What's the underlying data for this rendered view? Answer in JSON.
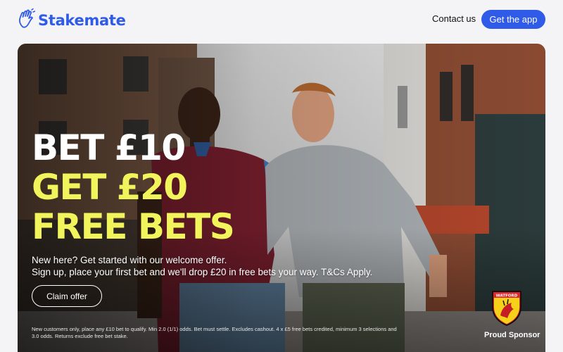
{
  "brand": {
    "name": "Stakemate",
    "color": "#2f5be8"
  },
  "nav": {
    "contact_label": "Contact us",
    "app_button_label": "Get the app"
  },
  "hero": {
    "headline_line1": "BET £10",
    "headline_line2": "GET £20",
    "headline_line3": "FREE BETS",
    "sub_line1": "New here? Get started with our welcome offer.",
    "sub_line2": "Sign up, place your first bet and we'll drop £20 in free bets your way. T&Cs Apply.",
    "cta_label": "Claim offer",
    "terms_line1": "New customers only, place any £10 bet to qualify. Min 2.0 (1/1) odds. Bet must settle. Excludes cashout. 4 x £5 free bets credited, minimum 3 selections and",
    "terms_line2": "3.0 odds. Returns exclude free bet stake.",
    "accent_color": "#f1f55b"
  },
  "sponsor": {
    "badge_text": "WATFORD",
    "label": "Proud Sponsor"
  }
}
